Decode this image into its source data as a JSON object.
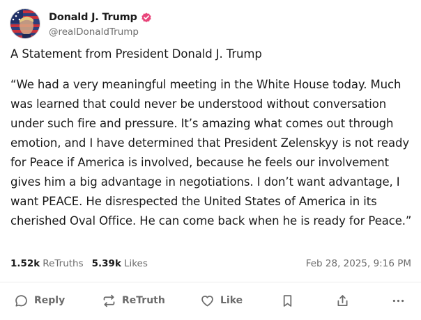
{
  "author": {
    "display_name": "Donald J. Trump",
    "handle": "@realDonaldTrump",
    "verified": true,
    "verified_color": "#e8457a"
  },
  "post": {
    "title": "A Statement from President Donald J. Trump",
    "body": "“We had a very meaningful meeting in the White House today. Much was learned that could never be understood without conversation under such fire and pressure. It’s amazing what comes out through emotion, and I have determined that President Zelenskyy is not ready for Peace if America is involved, because he feels our involvement gives him a big advantage in negotiations. I don’t want advantage, I want PEACE. He disrespected the United States of America in its cherished Oval Office. He can come back when he is ready for Peace.”",
    "retruths_count": "1.52k",
    "retruths_label": "ReTruths",
    "likes_count": "5.39k",
    "likes_label": "Likes",
    "timestamp": "Feb 28, 2025, 9:16 PM"
  },
  "actions": {
    "reply_label": "Reply",
    "retruth_label": "ReTruth",
    "like_label": "Like",
    "bookmark_icon": "bookmark-icon",
    "share_icon": "share-icon",
    "more_icon": "more-icon"
  },
  "colors": {
    "text": "#1a1a1a",
    "muted": "#6b6b6b",
    "accent": "#e8457a"
  }
}
